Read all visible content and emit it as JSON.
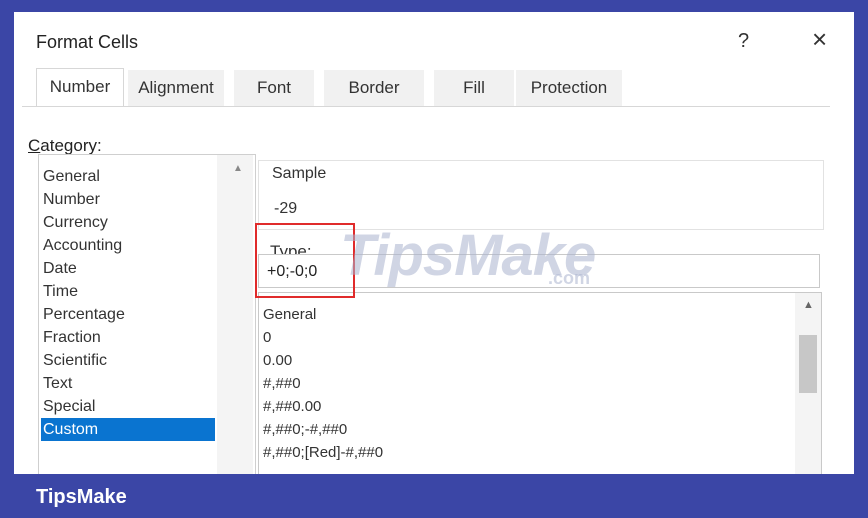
{
  "dialog": {
    "title": "Format Cells",
    "help_label": "?",
    "close_label": "×"
  },
  "tabs": [
    {
      "label": "Number",
      "active": true
    },
    {
      "label": "Alignment",
      "active": false
    },
    {
      "label": "Font",
      "active": false
    },
    {
      "label": "Border",
      "active": false
    },
    {
      "label": "Fill",
      "active": false
    },
    {
      "label": "Protection",
      "active": false
    }
  ],
  "category": {
    "label_first": "C",
    "label_rest": "ategory:",
    "items": [
      "General",
      "Number",
      "Currency",
      "Accounting",
      "Date",
      "Time",
      "Percentage",
      "Fraction",
      "Scientific",
      "Text",
      "Special",
      "Custom"
    ],
    "selected": "Custom"
  },
  "sample": {
    "legend": "Sample",
    "value": "-29"
  },
  "type": {
    "label_first": "T",
    "label_rest": "ype:",
    "value": "+0;-0;0",
    "formats": [
      "General",
      "0",
      "0.00",
      "#,##0",
      "#,##0.00",
      "#,##0;-#,##0",
      "#,##0;[Red]-#,##0"
    ]
  },
  "watermark": {
    "text": "TipsMake",
    "suffix": ".com"
  },
  "footer": {
    "brand": "TipsMake"
  },
  "colors": {
    "frame": "#3b46a6",
    "selection": "#0a74d0",
    "highlight": "#e02b2b"
  },
  "icons": {
    "help": "question-mark",
    "close": "close-x",
    "scroll_up": "chevron-up"
  }
}
